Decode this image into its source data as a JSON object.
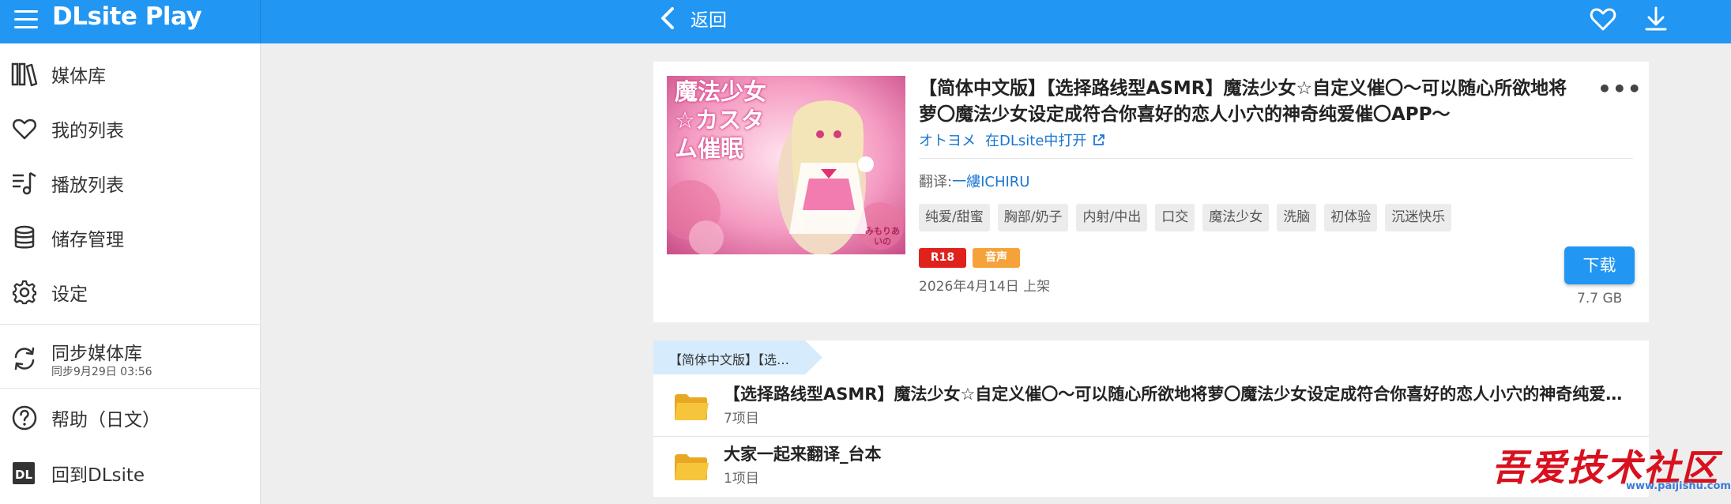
{
  "app": {
    "title": "DLsite Play",
    "back_label": "返回"
  },
  "sidebar": {
    "items": [
      {
        "label": "媒体库",
        "icon": "library-icon"
      },
      {
        "label": "我的列表",
        "icon": "heart-icon"
      },
      {
        "label": "播放列表",
        "icon": "playlist-icon"
      },
      {
        "label": "储存管理",
        "icon": "database-icon"
      },
      {
        "label": "设定",
        "icon": "gear-icon"
      },
      {
        "label": "同步媒体库",
        "sub": "同步9月29日 03:56",
        "icon": "sync-icon"
      },
      {
        "label": "帮助（日文）",
        "icon": "help-icon"
      },
      {
        "label": "回到DLsite",
        "icon": "dl-logo-icon"
      }
    ]
  },
  "product": {
    "title": "【简体中文版】【选择路线型ASMR】魔法少女☆自定义催〇～可以随心所欲地将萝〇魔法少女设定成符合你喜好的恋人小穴的神奇纯爱催〇APP～",
    "circle": "オトヨメ",
    "open_in_dlsite": "在DLsite中打开",
    "translator_label": "翻译:",
    "translator_name": "一縷ICHIRU",
    "tags": [
      "纯爱/甜蜜",
      "胸部/奶子",
      "内射/中出",
      "口交",
      "魔法少女",
      "洗脑",
      "初体验",
      "沉迷快乐"
    ],
    "badges": [
      {
        "label": "R18",
        "color": "#e0221c"
      },
      {
        "label": "音声",
        "color": "#f5a23a"
      }
    ],
    "release_date": "2026年4月14日 上架",
    "download_label": "下载",
    "size": "7.7 GB",
    "cover_text": "魔法少女☆カスタム催眠",
    "cover_author": "みもりあいの"
  },
  "files": {
    "breadcrumb": "【简体中文版】【选…",
    "items": [
      {
        "name": "【选择路线型ASMR】魔法少女☆自定义催〇～可以随心所欲地将萝〇魔法少女设定成符合你喜好的恋人小穴的神奇纯爱催〇APP～",
        "count": "7项目"
      },
      {
        "name": "大家一起来翻译_台本",
        "count": "1项目"
      }
    ]
  },
  "watermark": {
    "text": "吾爱技术社区",
    "url": "www.paijishu.com"
  },
  "colors": {
    "accent": "#2196f3",
    "link": "#1976d2",
    "r18": "#e0221c",
    "voice": "#f5a23a",
    "folder": "#f7c53c"
  }
}
